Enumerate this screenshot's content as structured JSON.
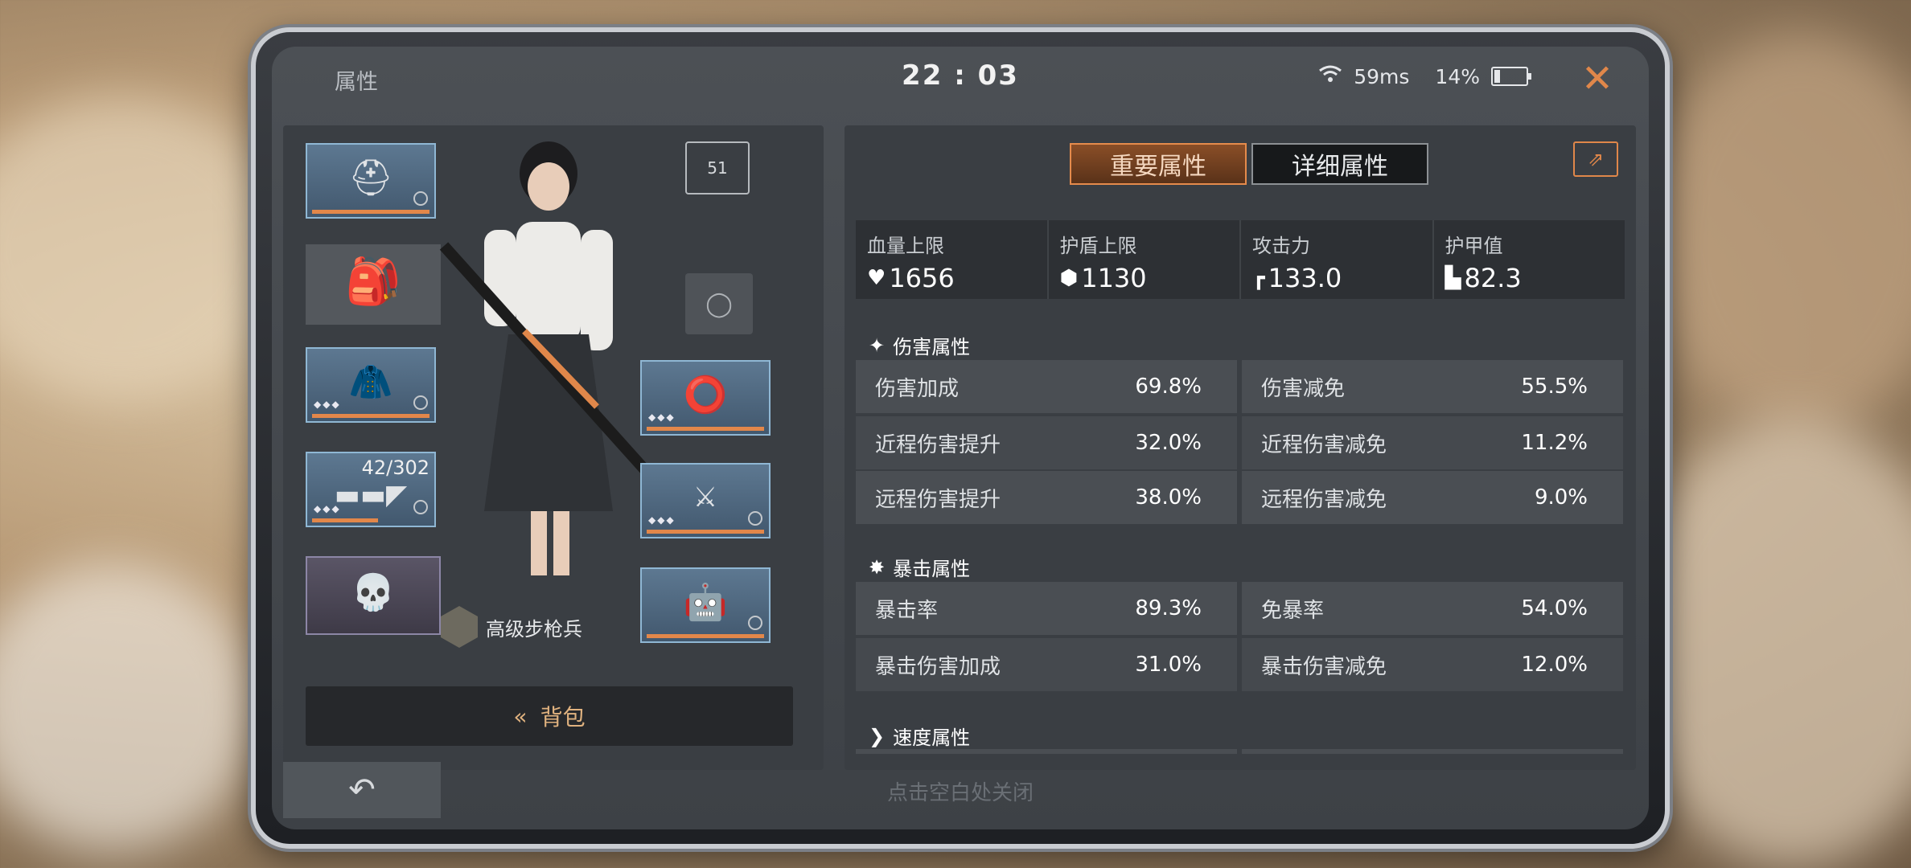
{
  "window": {
    "title": "属性",
    "clock": "22 : 03",
    "ping": "59ms",
    "battery": "14%",
    "close_icon": "close-icon"
  },
  "equipment": {
    "slots": [
      {
        "name": "helmet",
        "icon": "helmet-icon"
      },
      {
        "name": "backpack",
        "icon": "backpack-icon"
      },
      {
        "name": "armor",
        "icon": "armor-icon",
        "stars": "◆◆◆"
      },
      {
        "name": "rifle",
        "icon": "rifle-icon",
        "stars": "◆◆◆",
        "ammo": "42/302"
      },
      {
        "name": "skull-accessory",
        "icon": "skull-icon"
      },
      {
        "name": "bracelet",
        "icon": "ring-icon",
        "stars": "◆◆◆"
      },
      {
        "name": "katana",
        "icon": "katana-icon",
        "stars": "◆◆◆"
      },
      {
        "name": "mech-pet",
        "icon": "mech-icon"
      }
    ],
    "rank_level": "51",
    "class_label": "高级步枪兵",
    "bag_button": "背包"
  },
  "tabs": [
    {
      "label": "重要属性",
      "active": true
    },
    {
      "label": "详细属性",
      "active": false
    }
  ],
  "summary": [
    {
      "label": "血量上限",
      "value": "1656",
      "icon": "heart-icon"
    },
    {
      "label": "护盾上限",
      "value": "1130",
      "icon": "shield-icon"
    },
    {
      "label": "攻击力",
      "value": "133.0",
      "icon": "gun-icon"
    },
    {
      "label": "护甲值",
      "value": "82.3",
      "icon": "vest-icon"
    }
  ],
  "sections": {
    "damage": {
      "title": "伤害属性",
      "stats": [
        {
          "label": "伤害加成",
          "value": "69.8%"
        },
        {
          "label": "伤害减免",
          "value": "55.5%"
        },
        {
          "label": "近程伤害提升",
          "value": "32.0%"
        },
        {
          "label": "近程伤害减免",
          "value": "11.2%"
        },
        {
          "label": "远程伤害提升",
          "value": "38.0%"
        },
        {
          "label": "远程伤害减免",
          "value": "9.0%"
        }
      ]
    },
    "crit": {
      "title": "暴击属性",
      "stats": [
        {
          "label": "暴击率",
          "value": "89.3%"
        },
        {
          "label": "免暴率",
          "value": "54.0%"
        },
        {
          "label": "暴击伤害加成",
          "value": "31.0%"
        },
        {
          "label": "暴击伤害减免",
          "value": "12.0%"
        }
      ]
    },
    "speed": {
      "title": "速度属性"
    }
  },
  "footer": {
    "close_hint": "点击空白处关闭",
    "back_icon": "undo-icon"
  },
  "colors": {
    "accent": "#e0874a",
    "slot_border": "#8fb7d4"
  }
}
